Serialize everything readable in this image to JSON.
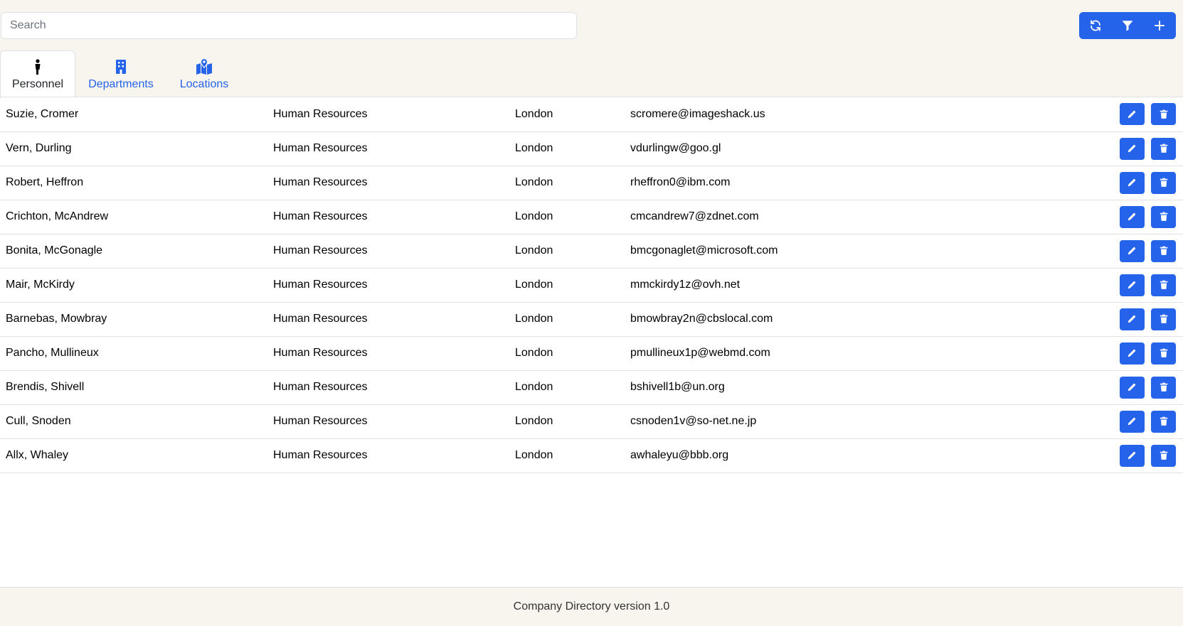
{
  "search": {
    "placeholder": "Search",
    "value": ""
  },
  "toolbar": {
    "buttons": [
      {
        "icon": "refresh-icon"
      },
      {
        "icon": "filter-icon"
      },
      {
        "icon": "plus-icon"
      }
    ]
  },
  "tabs": [
    {
      "label": "Personnel",
      "icon": "person-icon",
      "active": true
    },
    {
      "label": "Departments",
      "icon": "building-icon",
      "active": false
    },
    {
      "label": "Locations",
      "icon": "map-location-icon",
      "active": false
    }
  ],
  "table": {
    "rows": [
      {
        "name": "Suzie, Cromer",
        "department": "Human Resources",
        "location": "London",
        "email": "scromere@imageshack.us"
      },
      {
        "name": "Vern, Durling",
        "department": "Human Resources",
        "location": "London",
        "email": "vdurlingw@goo.gl"
      },
      {
        "name": "Robert, Heffron",
        "department": "Human Resources",
        "location": "London",
        "email": "rheffron0@ibm.com"
      },
      {
        "name": "Crichton, McAndrew",
        "department": "Human Resources",
        "location": "London",
        "email": "cmcandrew7@zdnet.com"
      },
      {
        "name": "Bonita, McGonagle",
        "department": "Human Resources",
        "location": "London",
        "email": "bmcgonaglet@microsoft.com"
      },
      {
        "name": "Mair, McKirdy",
        "department": "Human Resources",
        "location": "London",
        "email": "mmckirdy1z@ovh.net"
      },
      {
        "name": "Barnebas, Mowbray",
        "department": "Human Resources",
        "location": "London",
        "email": "bmowbray2n@cbslocal.com"
      },
      {
        "name": "Pancho, Mullineux",
        "department": "Human Resources",
        "location": "London",
        "email": "pmullineux1p@webmd.com"
      },
      {
        "name": "Brendis, Shivell",
        "department": "Human Resources",
        "location": "London",
        "email": "bshivell1b@un.org"
      },
      {
        "name": "Cull, Snoden",
        "department": "Human Resources",
        "location": "London",
        "email": "csnoden1v@so-net.ne.jp"
      },
      {
        "name": "Allx, Whaley",
        "department": "Human Resources",
        "location": "London",
        "email": "awhaleyu@bbb.org"
      }
    ],
    "row_actions": [
      {
        "icon": "pencil-icon"
      },
      {
        "icon": "trash-icon"
      }
    ]
  },
  "footer": {
    "text": "Company Directory version 1.0"
  },
  "colors": {
    "accent": "#2563eb",
    "header_bg": "#f7f5ee",
    "border": "#dee2e6"
  }
}
